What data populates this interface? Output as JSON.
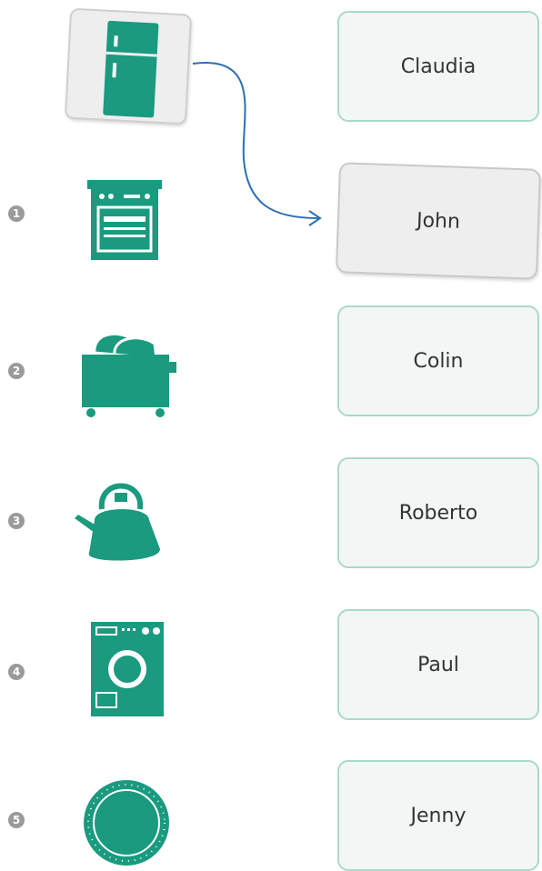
{
  "colors": {
    "accent": "#1a9a7f",
    "card_border": "#a9d9cc",
    "card_bg": "#f2f7f6",
    "arrow": "#2c6fb5",
    "number_badge": "#9a9a9a"
  },
  "example": {
    "icon": "fridge-icon",
    "matched_name": "John"
  },
  "items": [
    {
      "number": "1",
      "icon": "oven-icon"
    },
    {
      "number": "2",
      "icon": "toaster-icon"
    },
    {
      "number": "3",
      "icon": "kettle-icon"
    },
    {
      "number": "4",
      "icon": "washing-machine-icon"
    },
    {
      "number": "5",
      "icon": "plate-icon"
    }
  ],
  "names": [
    "Claudia",
    "John",
    "Colin",
    "Roberto",
    "Paul",
    "Jenny"
  ]
}
